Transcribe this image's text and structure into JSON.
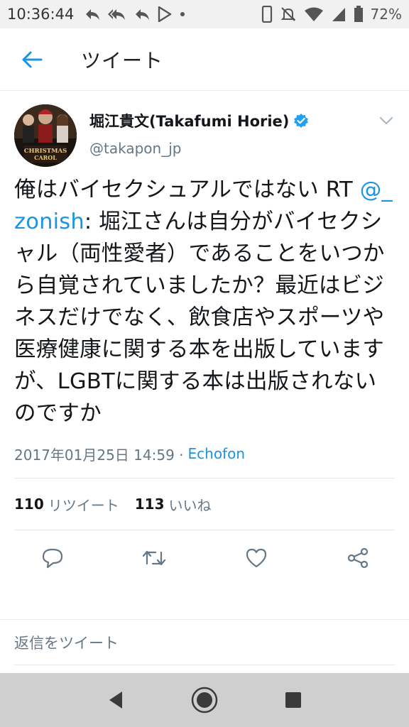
{
  "status_bar": {
    "time": "10:36:44",
    "battery": "72%",
    "left_icons": [
      "reply-icon",
      "reply-all-icon",
      "reply-icon",
      "play-store-icon",
      "dot-icon"
    ],
    "right_icons": [
      "phone-icon",
      "mute-icon",
      "wifi-icon",
      "signal-icon",
      "battery-icon"
    ]
  },
  "header": {
    "title": "ツイート"
  },
  "tweet": {
    "display_name": "堀江貴文(Takafumi Horie)",
    "screen_name": "@takapon_jp",
    "avatar_text": "CHRISTMAS CAROL",
    "text_before": "俺はバイセクシュアルではない RT ",
    "mention": "@_zonish",
    "text_after": ": 堀江さんは自分がバイセクシャル（両性愛者）であることをいつから自覚されていましたか？最近はビジネスだけでなく、飲食店やスポーツや医療健康に関する本を出版していますが、LGBTに関する本は出版されないのですか",
    "timestamp": "2017年01月25日 14:59 ·",
    "source": "Echofon",
    "retweet_count": "110",
    "retweet_label": "リツイート",
    "like_count": "113",
    "like_label": "いいね"
  },
  "reply": {
    "placeholder": "返信をツイート"
  },
  "colors": {
    "accent": "#1b95e0",
    "secondary_text": "#657786",
    "icon_gray": "#657786"
  }
}
